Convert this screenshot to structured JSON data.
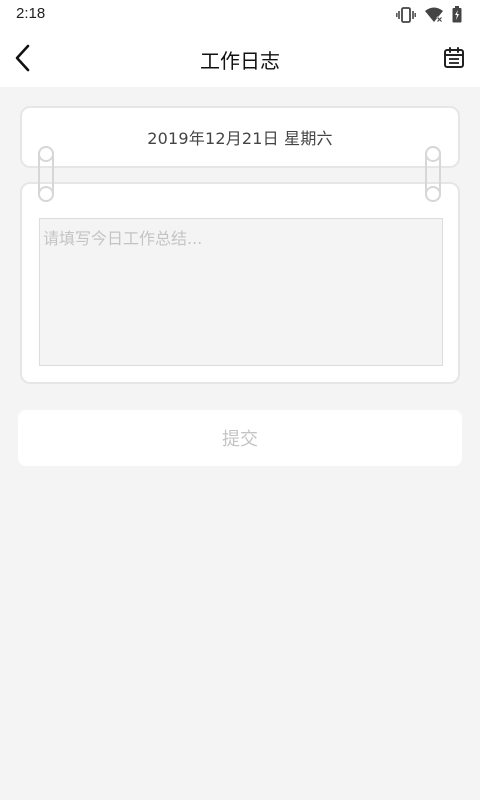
{
  "status_bar": {
    "time": "2:18",
    "icons": [
      "vibrate-icon",
      "wifi-icon",
      "battery-charging-icon"
    ]
  },
  "header": {
    "title": "工作日志",
    "back_icon": "chevron-left-icon",
    "action_icon": "calendar-icon"
  },
  "date_card": {
    "date": "2019年12月21日 星期六"
  },
  "log": {
    "value": "",
    "placeholder": "请填写今日工作总结..."
  },
  "submit": {
    "label": "提交"
  },
  "colors": {
    "background": "#f4f4f4",
    "card": "#ffffff",
    "border": "#e6e6e6",
    "placeholder": "#c4c4c4",
    "text": "#444444"
  }
}
